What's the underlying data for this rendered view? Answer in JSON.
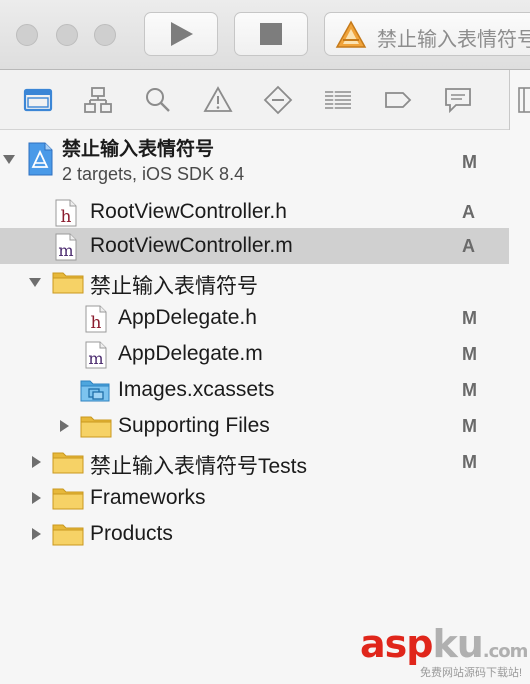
{
  "toolbar": {
    "scheme_title": "禁止输入表情符号",
    "run_icon": "play-icon",
    "stop_icon": "stop-icon"
  },
  "navigator_tabs": [
    {
      "name": "project-navigator-icon",
      "selected": true
    },
    {
      "name": "symbol-navigator-icon"
    },
    {
      "name": "find-navigator-icon"
    },
    {
      "name": "issue-navigator-icon"
    },
    {
      "name": "test-navigator-icon"
    },
    {
      "name": "debug-navigator-icon"
    },
    {
      "name": "breakpoint-navigator-icon"
    },
    {
      "name": "report-navigator-icon"
    }
  ],
  "project": {
    "name": "禁止输入表情符号",
    "subtitle": "2 targets, iOS SDK 8.4",
    "badge": "M"
  },
  "files": [
    {
      "label": "RootViewController.h",
      "badge": "A",
      "icon": "h-file-icon"
    },
    {
      "label": "RootViewController.m",
      "badge": "A",
      "icon": "m-file-icon",
      "selected": true
    },
    {
      "label": "禁止输入表情符号",
      "badge": "",
      "icon": "folder-icon",
      "expanded": true
    },
    {
      "label": "AppDelegate.h",
      "badge": "M",
      "icon": "h-file-icon"
    },
    {
      "label": "AppDelegate.m",
      "badge": "M",
      "icon": "m-file-icon"
    },
    {
      "label": "Images.xcassets",
      "badge": "M",
      "icon": "asset-catalog-icon"
    },
    {
      "label": "Supporting Files",
      "badge": "M",
      "icon": "folder-icon",
      "expanded": false
    },
    {
      "label": "禁止输入表情符号Tests",
      "badge": "M",
      "icon": "folder-icon",
      "expanded": false
    },
    {
      "label": "Frameworks",
      "badge": "",
      "icon": "folder-icon",
      "expanded": false
    },
    {
      "label": "Products",
      "badge": "",
      "icon": "folder-icon",
      "expanded": false
    }
  ],
  "watermark": {
    "brand_a": "asp",
    "brand_b": "ku",
    "brand_c": ".com",
    "tagline": "免费网站源码下载站!"
  },
  "colors": {
    "selection": "#d0d0d0",
    "folder": "#f3c94a",
    "h_icon_letter": "#8b1c2e",
    "m_icon_letter": "#4a2a6e",
    "asset_icon": "#5fb2e6",
    "watermark_red": "#e0261b",
    "watermark_gray": "#9a9a9a"
  }
}
